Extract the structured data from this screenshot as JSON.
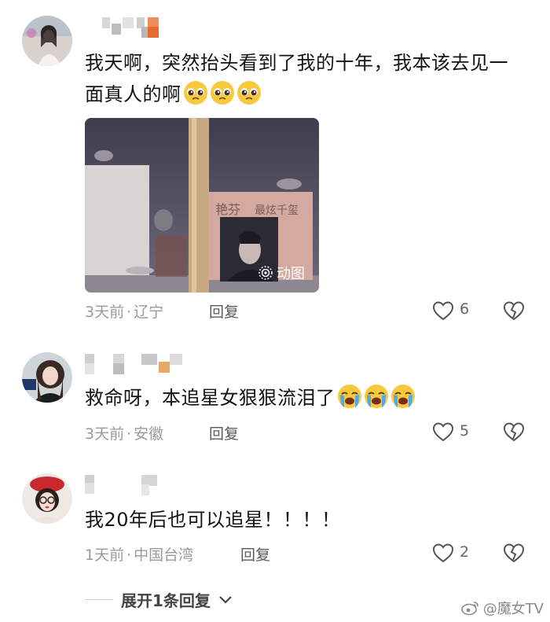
{
  "comments": [
    {
      "text": "我天啊，突然抬头看到了我的十年，我本该去见一面真人的啊",
      "emoji": [
        "pleading-face",
        "pleading-face",
        "pleading-face"
      ],
      "time": "3天前",
      "location": "辽宁",
      "reply_label": "回复",
      "likes": "6",
      "media": {
        "badge": "动图",
        "sign_text_1": "艳芬",
        "sign_text_2": "最炫千玺"
      }
    },
    {
      "text": "救命呀，本追星女狠狠流泪了",
      "emoji": [
        "loudly-crying-face",
        "loudly-crying-face",
        "loudly-crying-face"
      ],
      "time": "3天前",
      "location": "安徽",
      "reply_label": "回复",
      "likes": "5"
    },
    {
      "text": "我20年后也可以追星！！！！",
      "time": "1天前",
      "location": "中国台湾",
      "reply_label": "回复",
      "likes": "2"
    }
  ],
  "expand_label": "展开1条回复",
  "watermark": "@魔女TV",
  "colors": {
    "text": "#141414",
    "meta": "#9a9a9a",
    "icon": "#555555"
  }
}
